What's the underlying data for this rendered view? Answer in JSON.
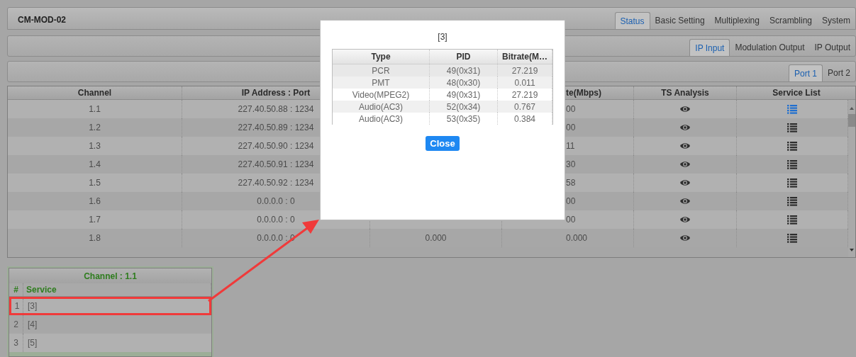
{
  "header": {
    "title": "CM-MOD-02",
    "tabs": [
      {
        "label": "Status",
        "selected": true
      },
      {
        "label": "Basic Setting",
        "selected": false
      },
      {
        "label": "Multiplexing",
        "selected": false
      },
      {
        "label": "Scrambling",
        "selected": false
      },
      {
        "label": "System",
        "selected": false
      }
    ]
  },
  "sub_tabs": [
    {
      "label": "IP Input",
      "selected": true
    },
    {
      "label": "Modulation Output",
      "selected": false
    },
    {
      "label": "IP Output",
      "selected": false
    }
  ],
  "port_tabs": [
    {
      "label": "Port 1",
      "selected": true
    },
    {
      "label": "Port 2",
      "selected": false
    }
  ],
  "table": {
    "columns": [
      "Channel",
      "IP Address : Port",
      null,
      "te(Mbps)",
      "TS Analysis",
      "Service List"
    ],
    "rows": [
      {
        "channel": "1.1",
        "ip": "227.40.50.88 : 1234",
        "column_4": "00",
        "selected": true
      },
      {
        "channel": "1.2",
        "ip": "227.40.50.89 : 1234",
        "column_4": "00",
        "selected": false
      },
      {
        "channel": "1.3",
        "ip": "227.40.50.90 : 1234",
        "column_4": "11",
        "selected": false
      },
      {
        "channel": "1.4",
        "ip": "227.40.50.91 : 1234",
        "column_4": "30",
        "selected": false
      },
      {
        "channel": "1.5",
        "ip": "227.40.50.92 : 1234",
        "column_4": "58",
        "selected": false
      },
      {
        "channel": "1.6",
        "ip": "0.0.0.0 : 0",
        "column_4": "00",
        "selected": false
      },
      {
        "channel": "1.7",
        "ip": "0.0.0.0 : 0",
        "column_4": "00",
        "selected": false
      },
      {
        "channel": "1.8",
        "ip": "0.0.0.0 : 0",
        "column_3": "0.000",
        "column_4": "0.000",
        "selected": false
      }
    ]
  },
  "service_panel": {
    "title": "Channel : 1.1",
    "columns": [
      "#",
      "Service"
    ],
    "rows": [
      {
        "index": "1",
        "service": "[3]",
        "highlighted": true
      },
      {
        "index": "2",
        "service": "[4]",
        "highlighted": false
      },
      {
        "index": "3",
        "service": "[5]",
        "highlighted": false
      }
    ]
  },
  "popup": {
    "title": "[3]",
    "columns": [
      "Type",
      "PID",
      "Bitrate(M…"
    ],
    "rows": [
      {
        "type": "PCR",
        "pid": "49(0x31)",
        "bitrate": "27.219"
      },
      {
        "type": "PMT",
        "pid": "48(0x30)",
        "bitrate": "0.011"
      },
      {
        "type": "Video(MPEG2)",
        "pid": "49(0x31)",
        "bitrate": "27.219"
      },
      {
        "type": "Audio(AC3)",
        "pid": "52(0x34)",
        "bitrate": "0.767"
      },
      {
        "type": "Audio(AC3)",
        "pid": "53(0x35)",
        "bitrate": "0.384"
      }
    ],
    "button": "Close"
  }
}
